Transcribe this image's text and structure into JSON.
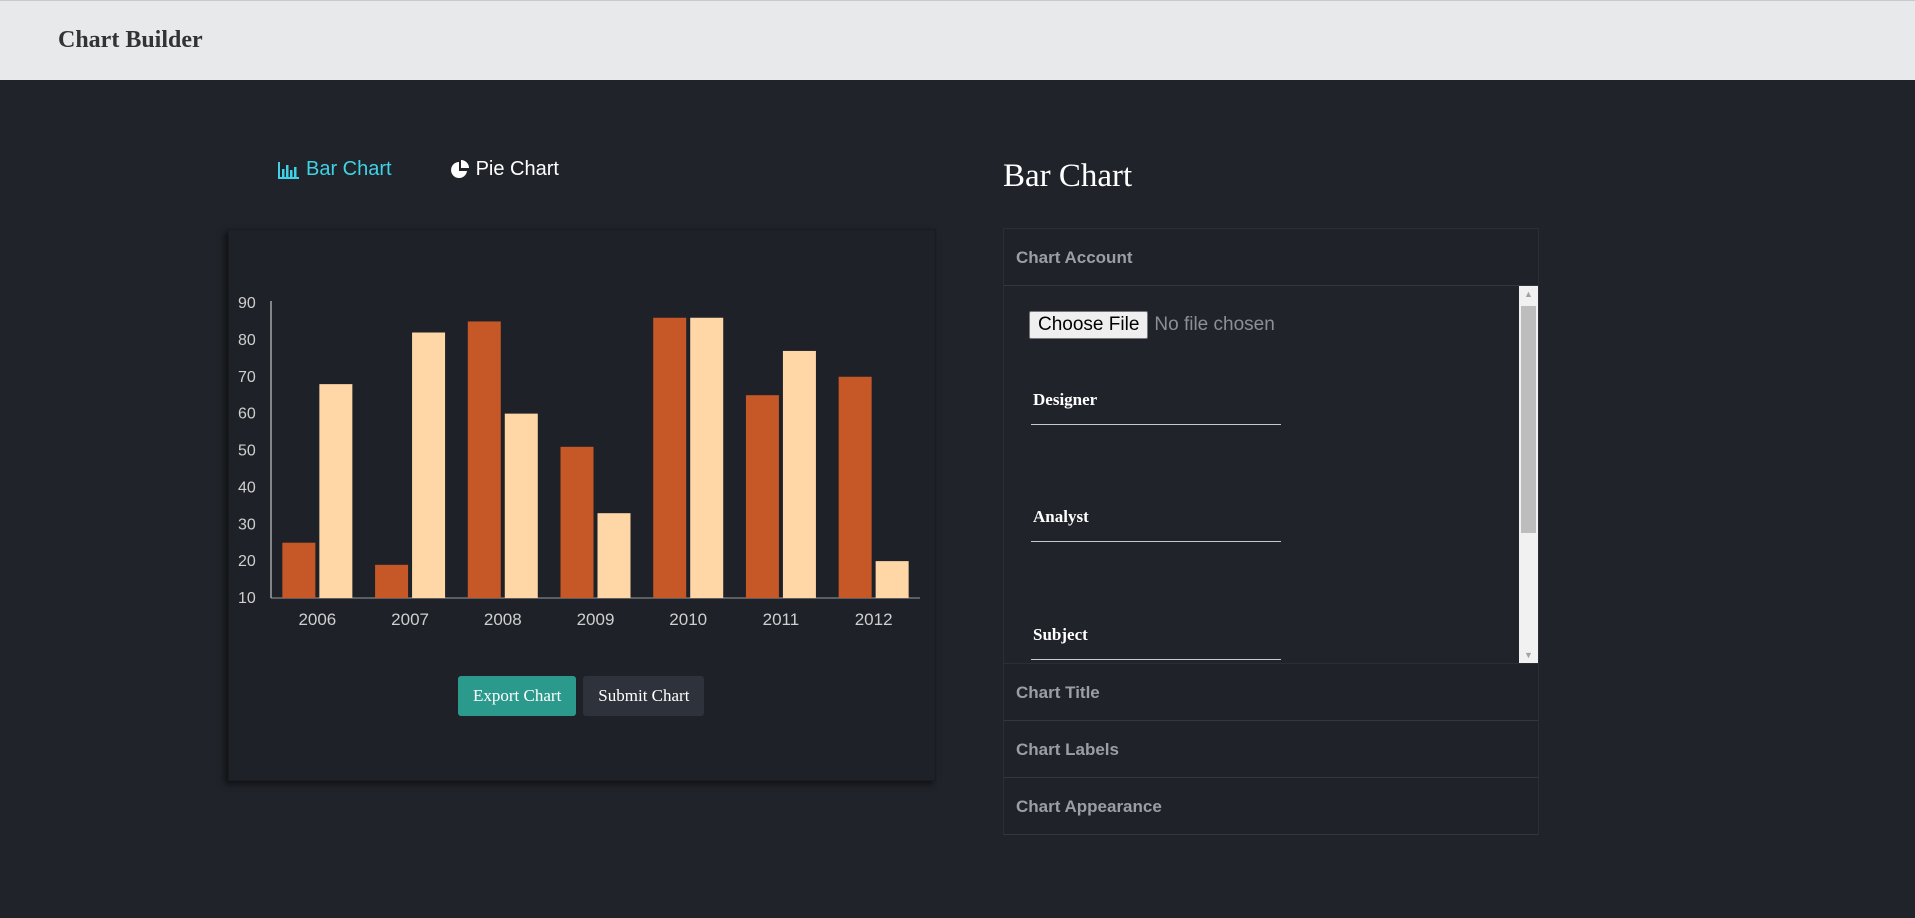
{
  "app": {
    "title": "Chart Builder"
  },
  "tabs": [
    {
      "label": "Bar Chart",
      "icon": "bar-chart-icon",
      "active": true
    },
    {
      "label": "Pie Chart",
      "icon": "pie-chart-icon",
      "active": false
    }
  ],
  "chart_data": {
    "type": "bar",
    "categories": [
      "2006",
      "2007",
      "2008",
      "2009",
      "2010",
      "2011",
      "2012"
    ],
    "series": [
      {
        "color": "#c65726",
        "values": [
          25,
          19,
          85,
          51,
          86,
          65,
          70
        ]
      },
      {
        "color": "#ffd7a7",
        "values": [
          68,
          82,
          60,
          33,
          86,
          77,
          20
        ]
      }
    ],
    "ylim": [
      10,
      90
    ],
    "yticks": [
      10,
      20,
      30,
      40,
      50,
      60,
      70,
      80,
      90
    ],
    "grid": false
  },
  "chart_buttons": {
    "export_label": "Export Chart",
    "submit_label": "Submit Chart"
  },
  "panel": {
    "title": "Bar Chart",
    "sections": {
      "account": "Chart Account",
      "title": "Chart Title",
      "labels": "Chart Labels",
      "appearance": "Chart Appearance"
    },
    "file_input": {
      "button_label": "Choose File",
      "status": "No file chosen"
    },
    "fields": {
      "designer": "Designer",
      "analyst": "Analyst",
      "subject": "Subject"
    }
  }
}
